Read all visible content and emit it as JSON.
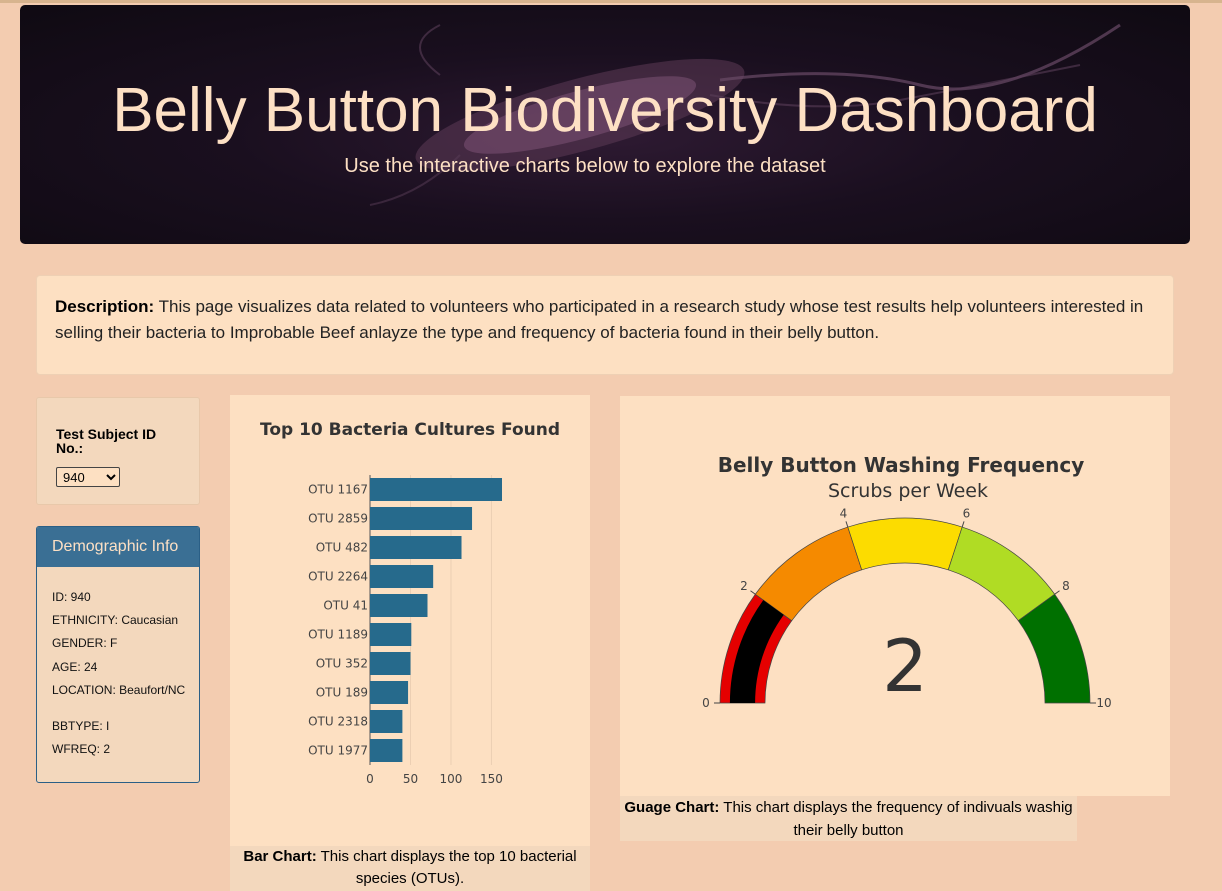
{
  "header": {
    "title": "Belly Button Biodiversity Dashboard",
    "subtitle": "Use the interactive charts below to explore the dataset"
  },
  "description": {
    "label": "Description:",
    "text": "This page visualizes data related to volunteers who participated in a research study whose test results help volunteers interested in selling their bacteria to Improbable Beef anlayze the type and frequency of bacteria found in their belly button."
  },
  "selector": {
    "label": "Test Subject ID No.:",
    "selected": "940",
    "options": [
      "940"
    ]
  },
  "demographics": {
    "title": "Demographic Info",
    "lines": [
      "ID: 940",
      "ETHNICITY: Caucasian",
      "GENDER: F",
      "AGE: 24",
      "LOCATION: Beaufort/NC",
      "BBTYPE: I",
      "WFREQ: 2"
    ]
  },
  "bar_caption": {
    "label": "Bar Chart:",
    "text": "This chart displays the top 10 bacterial species (OTUs)."
  },
  "gauge_caption": {
    "label": "Guage Chart:",
    "text": "This chart displays the frequency of indivuals washig their belly button"
  },
  "chart_data": [
    {
      "type": "bar",
      "orientation": "horizontal",
      "title": "Top 10 Bacteria Cultures Found",
      "categories": [
        "OTU 1167",
        "OTU 2859",
        "OTU 482",
        "OTU 2264",
        "OTU 41",
        "OTU 1189",
        "OTU 352",
        "OTU 189",
        "OTU 2318",
        "OTU 1977"
      ],
      "values": [
        163,
        126,
        113,
        78,
        71,
        51,
        50,
        47,
        40,
        40
      ],
      "xlim": [
        0,
        163
      ],
      "xticks": [
        0,
        50,
        100,
        150
      ],
      "grid": true,
      "color": "#266a8c"
    },
    {
      "type": "gauge",
      "title": "Belly Button Washing Frequency",
      "subtitle": "Scrubs per Week",
      "value": 2,
      "range": [
        0,
        10
      ],
      "ticks": [
        0,
        2,
        4,
        6,
        8,
        10
      ],
      "steps": [
        {
          "range": [
            0,
            2
          ],
          "color": "#e50000"
        },
        {
          "range": [
            2,
            4
          ],
          "color": "#f58a00"
        },
        {
          "range": [
            4,
            6
          ],
          "color": "#fcdc00"
        },
        {
          "range": [
            6,
            8
          ],
          "color": "#b0dc24"
        },
        {
          "range": [
            8,
            10
          ],
          "color": "#007000"
        }
      ],
      "bar_color": "#000000"
    }
  ]
}
